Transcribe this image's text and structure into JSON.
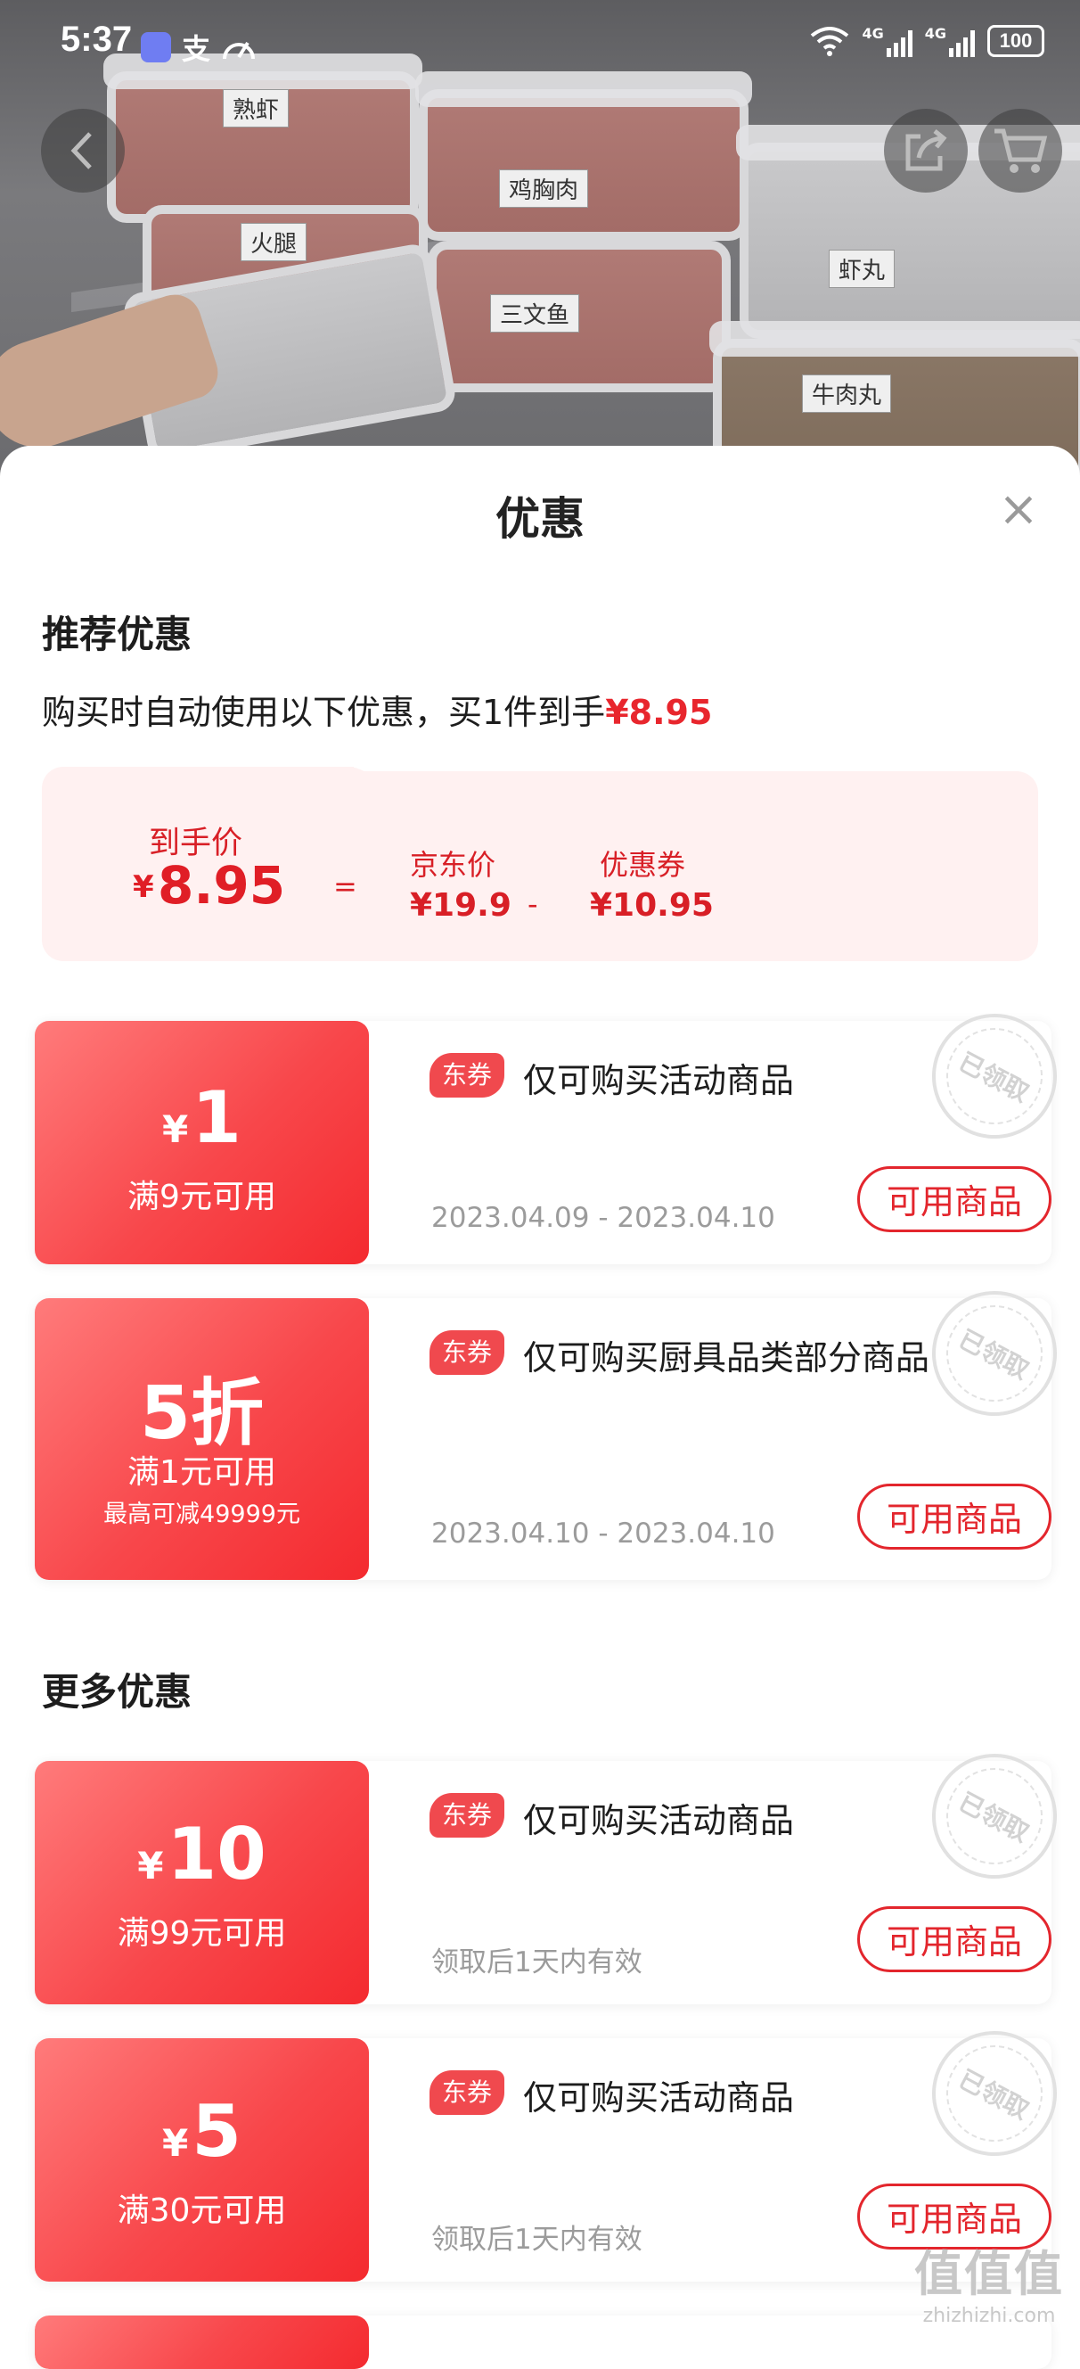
{
  "status_bar": {
    "time": "5:37",
    "signal1": "4G",
    "signal2": "4G",
    "battery": "100"
  },
  "product_image": {
    "labels": [
      "熟虾",
      "鸡胸肉",
      "火腿",
      "三文鱼",
      "虾丸",
      "牛肉丸"
    ]
  },
  "sheet": {
    "title": "优惠",
    "close_icon": "×",
    "recommended_title": "推荐优惠",
    "auto_use_text": "购买时自动使用以下优惠，买1件到手",
    "auto_use_price": "¥8.95",
    "summary": {
      "final_label": "到手价",
      "final_currency": "¥",
      "final_value": "8.95",
      "equals": "=",
      "jd_label": "京东价",
      "jd_value": "¥19.9",
      "minus": "-",
      "coupon_label": "优惠券",
      "coupon_value": "¥10.95"
    },
    "more_title": "更多优惠"
  },
  "coupons": [
    {
      "currency": "¥",
      "amount": "1",
      "condition": "满9元可用",
      "badge": "东券",
      "title": "仅可购买活动商品",
      "validity": "2023.04.09 - 2023.04.10",
      "button": "可用商品",
      "stamp": "已领取"
    },
    {
      "amount": "5折",
      "condition": "满1元可用",
      "extra": "最高可减49999元",
      "badge": "东券",
      "title": "仅可购买厨具品类部分商品",
      "validity": "2023.04.10 - 2023.04.10",
      "button": "可用商品",
      "stamp": "已领取"
    },
    {
      "currency": "¥",
      "amount": "10",
      "condition": "满99元可用",
      "badge": "东券",
      "title": "仅可购买活动商品",
      "validity": "领取后1天内有效",
      "button": "可用商品",
      "stamp": "已领取"
    },
    {
      "currency": "¥",
      "amount": "5",
      "condition": "满30元可用",
      "badge": "东券",
      "title": "仅可购买活动商品",
      "validity": "领取后1天内有效",
      "button": "可用商品",
      "stamp": "已领取"
    }
  ],
  "watermark": {
    "glyphs": "值值值",
    "site": "zhizhizhi.com"
  },
  "colors": {
    "accent_red": "#e3262d",
    "coupon_gradient_start": "#ff7b7b",
    "coupon_gradient_end": "#f42a2f",
    "summary_bg": "#fff1f1"
  }
}
